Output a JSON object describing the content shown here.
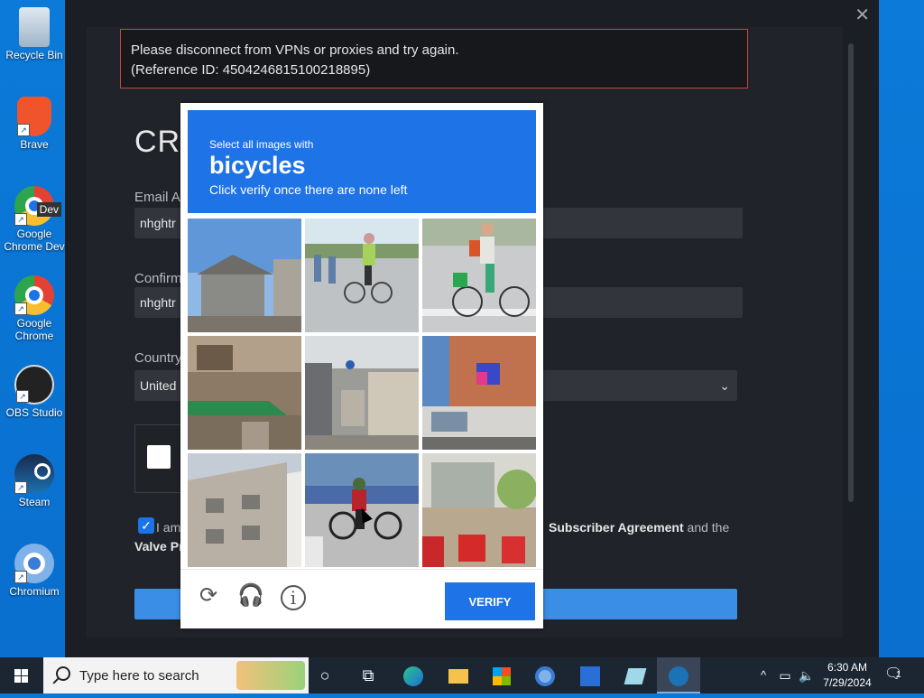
{
  "desktop_icons": [
    {
      "label": "Recycle Bin",
      "icon": "recycle-bin-icon"
    },
    {
      "label": "Brave",
      "icon": "brave-icon"
    },
    {
      "label": "Google Chrome Dev",
      "icon": "chrome-dev-icon",
      "badge": "Dev"
    },
    {
      "label": "Google Chrome",
      "icon": "chrome-icon"
    },
    {
      "label": "OBS Studio",
      "icon": "obs-icon"
    },
    {
      "label": "Steam",
      "icon": "steam-icon"
    },
    {
      "label": "Chromium",
      "icon": "chromium-icon"
    }
  ],
  "steam": {
    "error_line1": "Please disconnect from VPNs or proxies and try again.",
    "error_line2": "(Reference ID: 4504246815100218895)",
    "title": "CR",
    "email_label": "Email A",
    "email_value": "nhghtr",
    "confirm_label": "Confirm",
    "confirm_value": "nhghtr",
    "country_label": "Country",
    "country_value": "United",
    "agree_prefix": "I am",
    "agree_link": "Subscriber Agreement",
    "agree_suffix": "and the",
    "valve_text": "Valve Pr"
  },
  "challenge": {
    "prompt_pre": "Select all images with",
    "prompt_word": "bicycles",
    "prompt_post": "Click verify once there are none left",
    "tiles": [
      {
        "subject": "house-sky"
      },
      {
        "subject": "cyclist-road"
      },
      {
        "subject": "woman-bicycle"
      },
      {
        "subject": "storefront-awning"
      },
      {
        "subject": "narrow-street"
      },
      {
        "subject": "shop-building"
      },
      {
        "subject": "white-building"
      },
      {
        "subject": "cyclist-parking"
      },
      {
        "subject": "scooters-tree"
      }
    ],
    "verify_label": "VERIFY"
  },
  "taskbar": {
    "search_placeholder": "Type here to search",
    "time": "6:30 AM",
    "date": "7/29/2024",
    "notification_count": "1"
  }
}
